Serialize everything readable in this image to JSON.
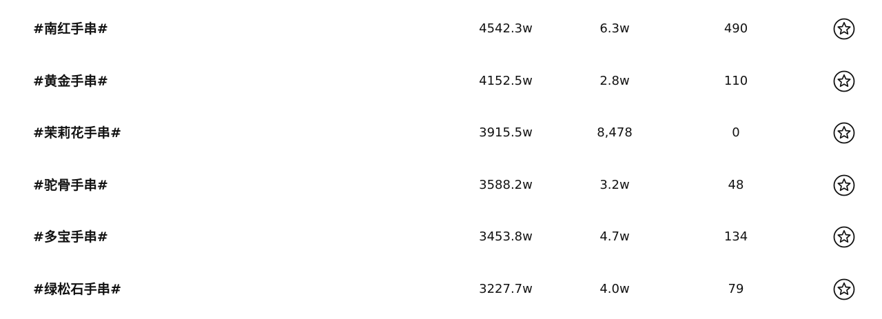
{
  "rows": [
    {
      "topic": "#南红手串#",
      "col1": "4542.3w",
      "col2": "6.3w",
      "col3": "490",
      "favorite_icon": "star-outline-icon"
    },
    {
      "topic": "#黄金手串#",
      "col1": "4152.5w",
      "col2": "2.8w",
      "col3": "110",
      "favorite_icon": "star-outline-icon"
    },
    {
      "topic": "#茉莉花手串#",
      "col1": "3915.5w",
      "col2": "8,478",
      "col3": "0",
      "favorite_icon": "star-outline-icon"
    },
    {
      "topic": "#驼骨手串#",
      "col1": "3588.2w",
      "col2": "3.2w",
      "col3": "48",
      "favorite_icon": "star-outline-icon"
    },
    {
      "topic": "#多宝手串#",
      "col1": "3453.8w",
      "col2": "4.7w",
      "col3": "134",
      "favorite_icon": "star-outline-icon"
    },
    {
      "topic": "#绿松石手串#",
      "col1": "3227.7w",
      "col2": "4.0w",
      "col3": "79",
      "favorite_icon": "star-outline-icon"
    }
  ]
}
